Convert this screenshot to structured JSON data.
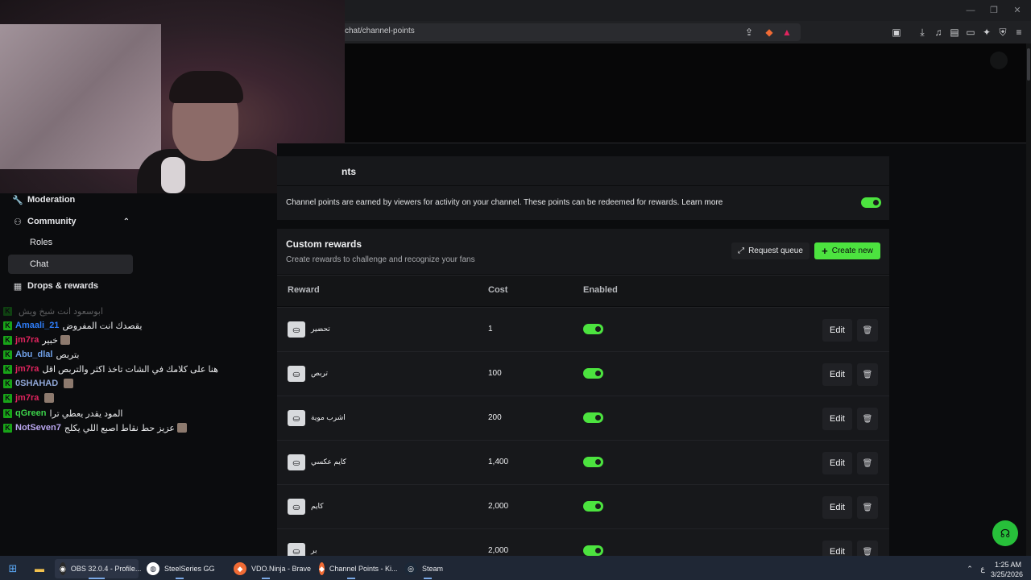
{
  "browser": {
    "url": "chat/channel-points"
  },
  "sidebar": {
    "items": [
      {
        "label": "Moderation",
        "icon": "wrench-icon"
      },
      {
        "label": "Community",
        "icon": "community-icon"
      },
      {
        "label": "Roles"
      },
      {
        "label": "Chat"
      },
      {
        "label": "Drops & rewards",
        "icon": "gift-icon"
      }
    ]
  },
  "chat": [
    {
      "user": "",
      "msg": "ابوسعود انت شيخ ويش",
      "color": "#c0392b",
      "faded": true
    },
    {
      "user": "Amaali_21",
      "msg": "يقصدك انت المفروض",
      "color": "#2e7cf6"
    },
    {
      "user": "jm7ra",
      "msg": "خبير",
      "color": "#e0245e"
    },
    {
      "user": "Abu_dlal",
      "msg": "بتربص",
      "color": "#6f9fe6"
    },
    {
      "user": "jm7ra",
      "msg": "هنا على كلامك في الشات تاخذ اكثر والتربص اقل",
      "color": "#e0245e"
    },
    {
      "user": "0SHAHAD",
      "msg": "",
      "color": "#8fa6d6"
    },
    {
      "user": "jm7ra",
      "msg": "",
      "color": "#e0245e"
    },
    {
      "user": "qGreen",
      "msg": "المود يقدر يعطي ترا",
      "color": "#3cd34a"
    },
    {
      "user": "NotSeven7",
      "msg": "عزيز حط نقاط اصبع اللي يكلج",
      "color": "#b9a6ee"
    }
  ],
  "page": {
    "section_title": "nts",
    "channel_points_desc": "Channel points are earned by viewers for activity on your channel. These points can be redeemed for rewards.",
    "learn_more": "Learn more",
    "custom_rewards_title": "Custom rewards",
    "custom_rewards_sub": "Create rewards to challenge and recognize your fans",
    "request_queue": "Request queue",
    "create_new": "Create new",
    "columns": {
      "reward": "Reward",
      "cost": "Cost",
      "enabled": "Enabled"
    },
    "edit_label": "Edit"
  },
  "rewards": [
    {
      "name": "تحضير",
      "cost": "1",
      "enabled": true
    },
    {
      "name": "تربص",
      "cost": "100",
      "enabled": true
    },
    {
      "name": "اشرب موية",
      "cost": "200",
      "enabled": true
    },
    {
      "name": "كايم عكسي",
      "cost": "1,400",
      "enabled": true
    },
    {
      "name": "كايم",
      "cost": "2,000",
      "enabled": true
    },
    {
      "name": "بر",
      "cost": "2,000",
      "enabled": true
    }
  ],
  "taskbar": {
    "apps": [
      {
        "label": "OBS 32.0.4 - Profile...",
        "active": true
      },
      {
        "label": "SteelSeries GG"
      },
      {
        "label": "VDO.Ninja - Brave"
      },
      {
        "label": "Channel Points - Ki..."
      },
      {
        "label": "Steam"
      }
    ],
    "lang": "ع",
    "time": "1:25 AM",
    "date": "3/25/2026"
  },
  "colors": {
    "accent": "#4ce33f",
    "kick_green": "#18a418"
  }
}
